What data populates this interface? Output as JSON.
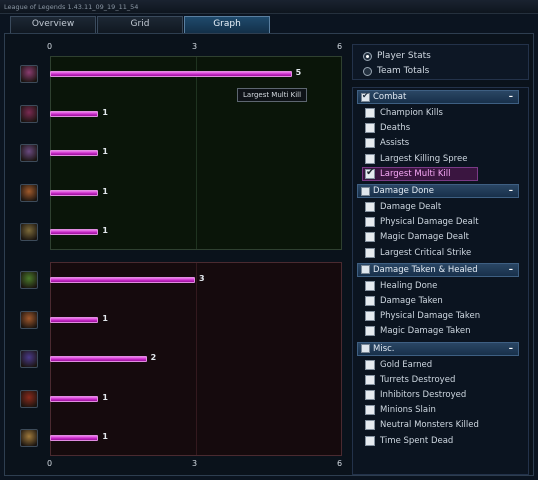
{
  "window": {
    "title": "League of Legends 1.43.11_09_19_11_54"
  },
  "tabs": [
    {
      "label": "Overview",
      "active": false
    },
    {
      "label": "Grid",
      "active": false
    },
    {
      "label": "Graph",
      "active": true
    }
  ],
  "chart_data": {
    "type": "bar",
    "orientation": "horizontal",
    "metric": "Largest Multi Kill",
    "xlim": [
      0,
      6
    ],
    "xticks": [
      "0",
      "3",
      "6"
    ],
    "grid": true,
    "teams": [
      {
        "values": [
          5,
          1,
          1,
          1,
          1
        ],
        "avatar_colors": [
          "#8a3c70",
          "#7a2a52",
          "#6a4a80",
          "#a05a2c",
          "#7c6a3a"
        ]
      },
      {
        "values": [
          3,
          1,
          2,
          1,
          1
        ],
        "avatar_colors": [
          "#4a7a2a",
          "#a0582c",
          "#4a3a8a",
          "#8a2a1c",
          "#a07a3c"
        ]
      }
    ]
  },
  "tooltip": {
    "text": "Largest Multi Kill"
  },
  "stats_mode": {
    "options": [
      {
        "label": "Player Stats",
        "selected": true
      },
      {
        "label": "Team Totals",
        "selected": false
      }
    ]
  },
  "groups": [
    {
      "label": "Combat",
      "checked": true,
      "collapse": "–",
      "items": [
        {
          "label": "Champion Kills",
          "checked": false
        },
        {
          "label": "Deaths",
          "checked": false
        },
        {
          "label": "Assists",
          "checked": false
        },
        {
          "label": "Largest Killing Spree",
          "checked": false
        },
        {
          "label": "Largest Multi Kill",
          "checked": true,
          "highlighted": true
        }
      ]
    },
    {
      "label": "Damage Done",
      "checked": false,
      "collapse": "–",
      "items": [
        {
          "label": "Damage Dealt",
          "checked": false
        },
        {
          "label": "Physical Damage Dealt",
          "checked": false
        },
        {
          "label": "Magic Damage Dealt",
          "checked": false
        },
        {
          "label": "Largest Critical Strike",
          "checked": false
        }
      ]
    },
    {
      "label": "Damage Taken & Healed",
      "checked": false,
      "collapse": "–",
      "items": [
        {
          "label": "Healing Done",
          "checked": false
        },
        {
          "label": "Damage Taken",
          "checked": false
        },
        {
          "label": "Physical Damage Taken",
          "checked": false
        },
        {
          "label": "Magic Damage Taken",
          "checked": false
        }
      ]
    },
    {
      "label": "Misc.",
      "checked": false,
      "collapse": "–",
      "items": [
        {
          "label": "Gold Earned",
          "checked": false
        },
        {
          "label": "Turrets Destroyed",
          "checked": false
        },
        {
          "label": "Inhibitors Destroyed",
          "checked": false
        },
        {
          "label": "Minions Slain",
          "checked": false
        },
        {
          "label": "Neutral Monsters Killed",
          "checked": false
        },
        {
          "label": "Time Spent Dead",
          "checked": false
        }
      ]
    }
  ]
}
